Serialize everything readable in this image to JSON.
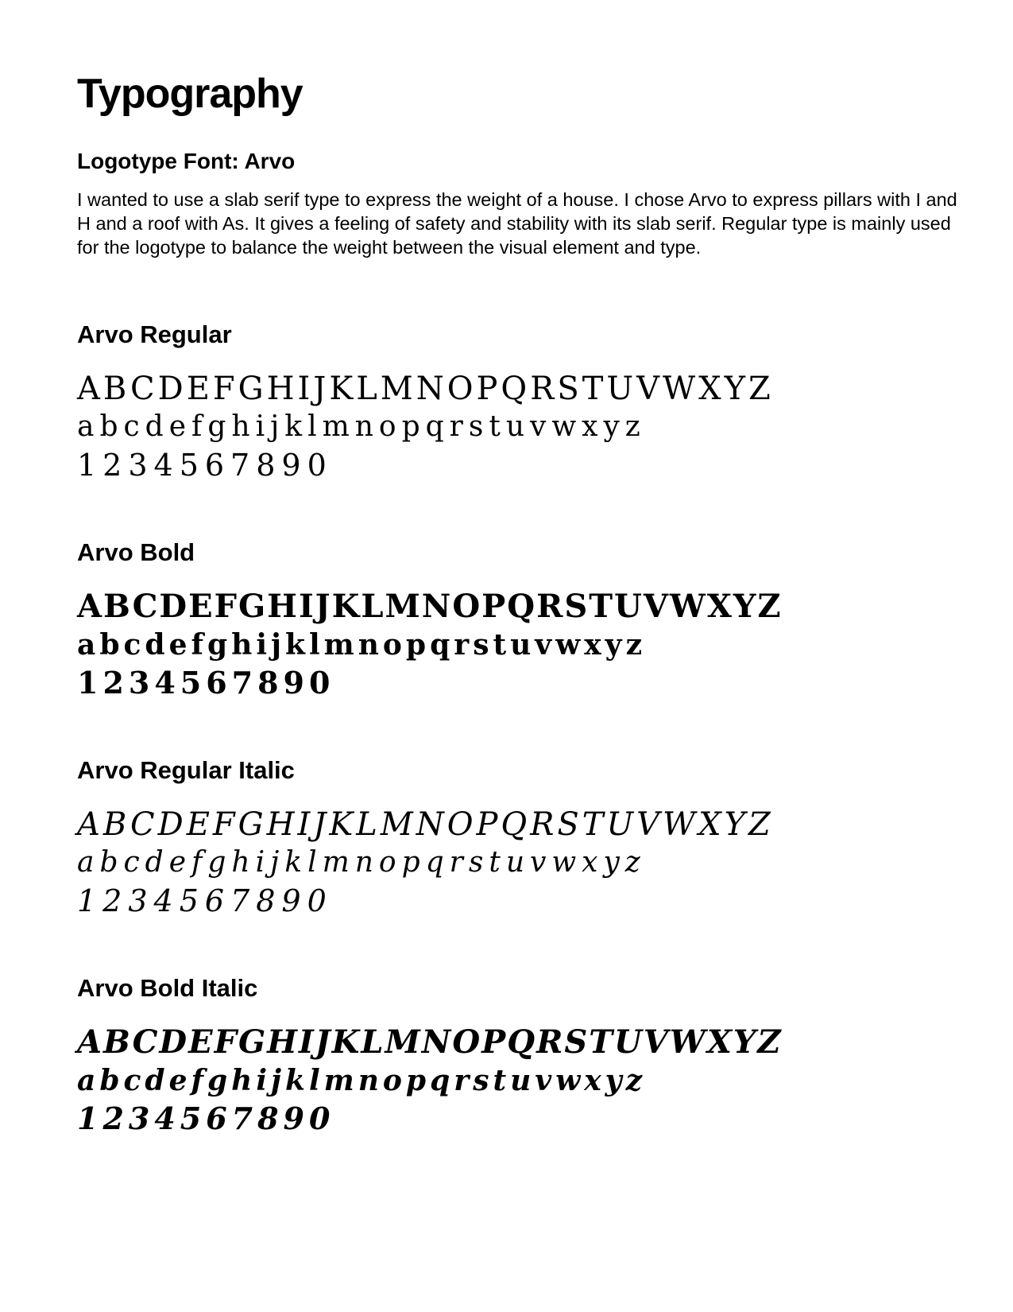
{
  "title": "Typography",
  "logotype_heading": "Logotype Font: Arvo",
  "intro_text": "I wanted to use a slab serif type to express the weight of a house. I chose Arvo to express pillars with I and H and a roof with As. It gives a feeling of safety and stability with its slab serif. Regular type is mainly used for the logotype to balance the weight between the visual element and type.",
  "sections": [
    {
      "name": "Arvo Regular",
      "uppercase": "ABCDEFGHIJKLMNOPQRSTUVWXYZ",
      "lowercase": "abcdefghijklmnopqrstuvwxyz",
      "digits": "1234567890"
    },
    {
      "name": "Arvo Bold",
      "uppercase": "ABCDEFGHIJKLMNOPQRSTUVWXYZ",
      "lowercase": "abcdefghijklmnopqrstuvwxyz",
      "digits": "1234567890"
    },
    {
      "name": "Arvo Regular Italic",
      "uppercase": "ABCDEFGHIJKLMNOPQRSTUVWXYZ",
      "lowercase": "abcdefghijklmnopqrstuvwxyz",
      "digits": "1234567890"
    },
    {
      "name": "Arvo Bold Italic",
      "uppercase": "ABCDEFGHIJKLMNOPQRSTUVWXYZ",
      "lowercase": "abcdefghijklmnopqrstuvwxyz",
      "digits": "1234567890"
    }
  ]
}
